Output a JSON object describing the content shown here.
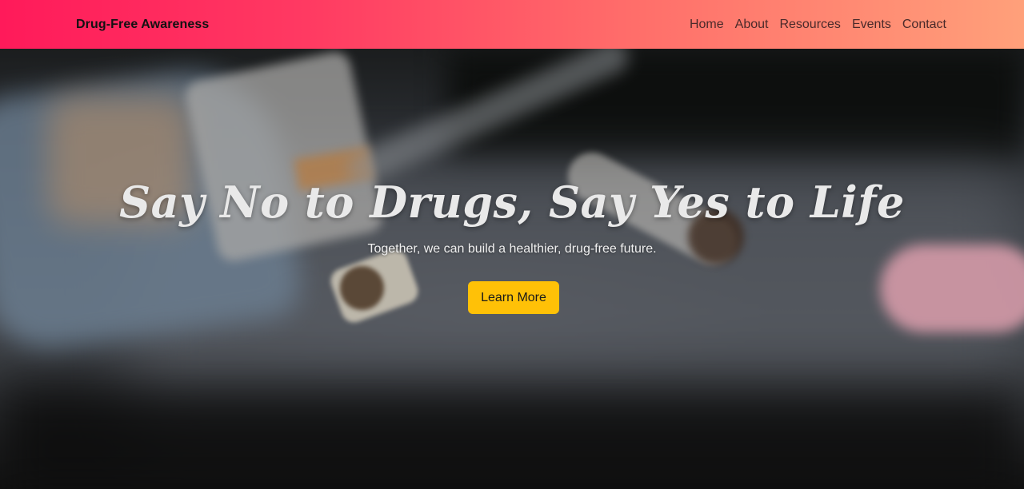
{
  "nav": {
    "brand": "Drug-Free Awareness",
    "links": [
      {
        "label": "Home"
      },
      {
        "label": "About"
      },
      {
        "label": "Resources"
      },
      {
        "label": "Events"
      },
      {
        "label": "Contact"
      }
    ]
  },
  "hero": {
    "title": "Say No to Drugs, Say Yes to Life",
    "subtitle": "Together, we can build a healthier, drug-free future.",
    "cta_label": "Learn More"
  },
  "colors": {
    "nav_gradient_start": "#ff1a5a",
    "nav_gradient_end": "#ffa07a",
    "cta_background": "#ffc107"
  }
}
